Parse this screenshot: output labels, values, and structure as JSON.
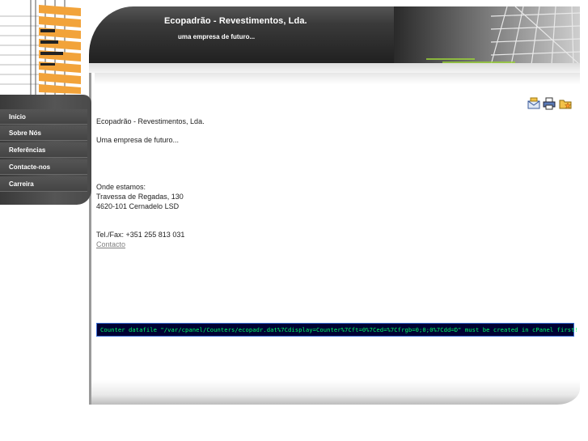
{
  "header": {
    "title": "Ecopadrão - Revestimentos, Lda.",
    "subtitle": "uma empresa de futuro..."
  },
  "nav": {
    "items": [
      {
        "label": "Início"
      },
      {
        "label": "Sobre Nós"
      },
      {
        "label": "Referências"
      },
      {
        "label": "Contacte-nos"
      },
      {
        "label": "Carreira"
      }
    ]
  },
  "toolbar": {
    "icons": [
      "email-icon",
      "print-icon",
      "favorites-icon"
    ]
  },
  "content": {
    "company": "Ecopadrão - Revestimentos, Lda.",
    "tagline": "Uma empresa de futuro...",
    "where_label": "Onde estamos:",
    "address_line1": "Travessa de Regadas, 130",
    "address_line2": "4620-101 Cernadelo LSD",
    "phone": "Tel./Fax: +351 255 813 031",
    "contact_link": "Contacto"
  },
  "counter": {
    "text": "Counter datafile \"/var/cpanel/Counters/ecopadr.dat%7Cdisplay=Counter%7Cft=0%7Ced=%7Cfrgb=0;0;0%7Cdd=D\" must be created in cPanel first!"
  },
  "colors": {
    "nav_bg": "#4a4a4a",
    "header_bg": "#2a2a2a",
    "counter_text": "#00ff66",
    "counter_bg": "#000033"
  }
}
